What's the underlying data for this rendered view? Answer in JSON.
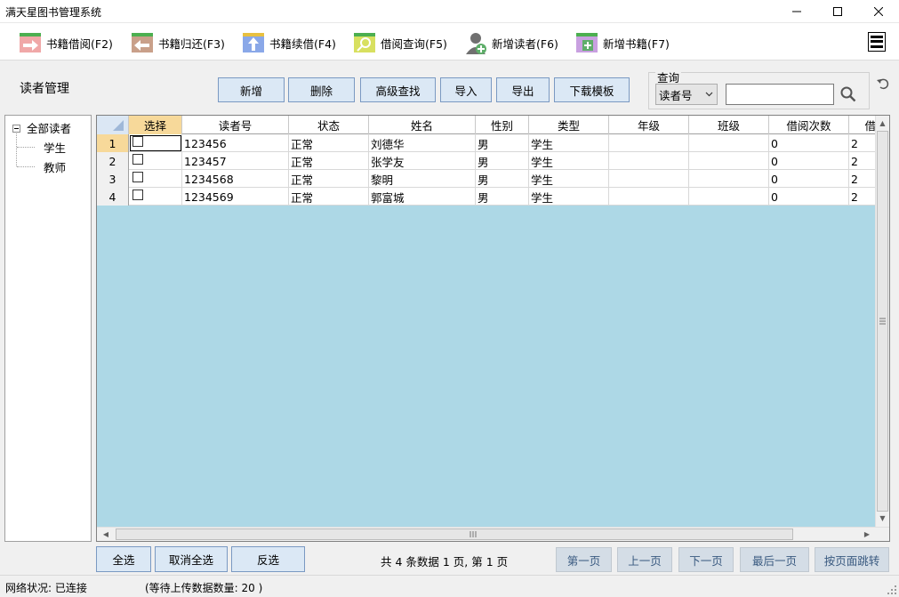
{
  "window": {
    "title": "满天星图书管理系统",
    "controls": {
      "minimize": "—",
      "maximize": "☐",
      "close": "✕"
    }
  },
  "toolbar": {
    "items": [
      {
        "label": "书籍借阅(F2)",
        "icon": "book-borrow-icon",
        "color": "#e8504a"
      },
      {
        "label": "书籍归还(F3)",
        "icon": "book-return-icon",
        "color": "#b8836a"
      },
      {
        "label": "书籍续借(F4)",
        "icon": "book-renew-icon",
        "color": "#6a8fd8"
      },
      {
        "label": "借阅查询(F5)",
        "icon": "borrow-search-icon",
        "color": "#c8d640"
      },
      {
        "label": "新增读者(F6)",
        "icon": "add-reader-icon",
        "color": "#5fae6a"
      },
      {
        "label": "新增书籍(F7)",
        "icon": "add-book-icon",
        "color": "#b88ad0"
      }
    ]
  },
  "section_title": "读者管理",
  "actions": {
    "add": "新增",
    "delete": "删除",
    "advanced_search": "高级查找",
    "import": "导入",
    "export": "导出",
    "download_template": "下载模板"
  },
  "query": {
    "label": "查询",
    "field_selected": "读者号",
    "search_value": ""
  },
  "tree": {
    "root": "全部读者",
    "children": [
      "学生",
      "教师"
    ]
  },
  "grid": {
    "columns": [
      "选择",
      "读者号",
      "状态",
      "姓名",
      "性别",
      "类型",
      "年级",
      "班级",
      "借阅次数",
      "借"
    ],
    "rows": [
      {
        "num": "1",
        "reader_id": "123456",
        "status": "正常",
        "name": "刘德华",
        "gender": "男",
        "type": "学生",
        "grade": "",
        "class": "",
        "borrow_count": "0",
        "extra": "2"
      },
      {
        "num": "2",
        "reader_id": "123457",
        "status": "正常",
        "name": "张学友",
        "gender": "男",
        "type": "学生",
        "grade": "",
        "class": "",
        "borrow_count": "0",
        "extra": "2"
      },
      {
        "num": "3",
        "reader_id": "1234568",
        "status": "正常",
        "name": "黎明",
        "gender": "男",
        "type": "学生",
        "grade": "",
        "class": "",
        "borrow_count": "0",
        "extra": "2"
      },
      {
        "num": "4",
        "reader_id": "1234569",
        "status": "正常",
        "name": "郭富城",
        "gender": "男",
        "type": "学生",
        "grade": "",
        "class": "",
        "borrow_count": "0",
        "extra": "2"
      }
    ],
    "colors": {
      "background": "#add8e6",
      "selected_header": "#f7d99a"
    }
  },
  "selection": {
    "select_all": "全选",
    "deselect_all": "取消全选",
    "invert": "反选"
  },
  "pagination": {
    "info": "共 4 条数据  1 页, 第 1 页",
    "first": "第一页",
    "prev": "上一页",
    "next": "下一页",
    "last": "最后一页",
    "jump": "按页面跳转"
  },
  "status": {
    "network": "网络状况:  已连接",
    "pending": "(等待上传数据数量: 20 )"
  }
}
